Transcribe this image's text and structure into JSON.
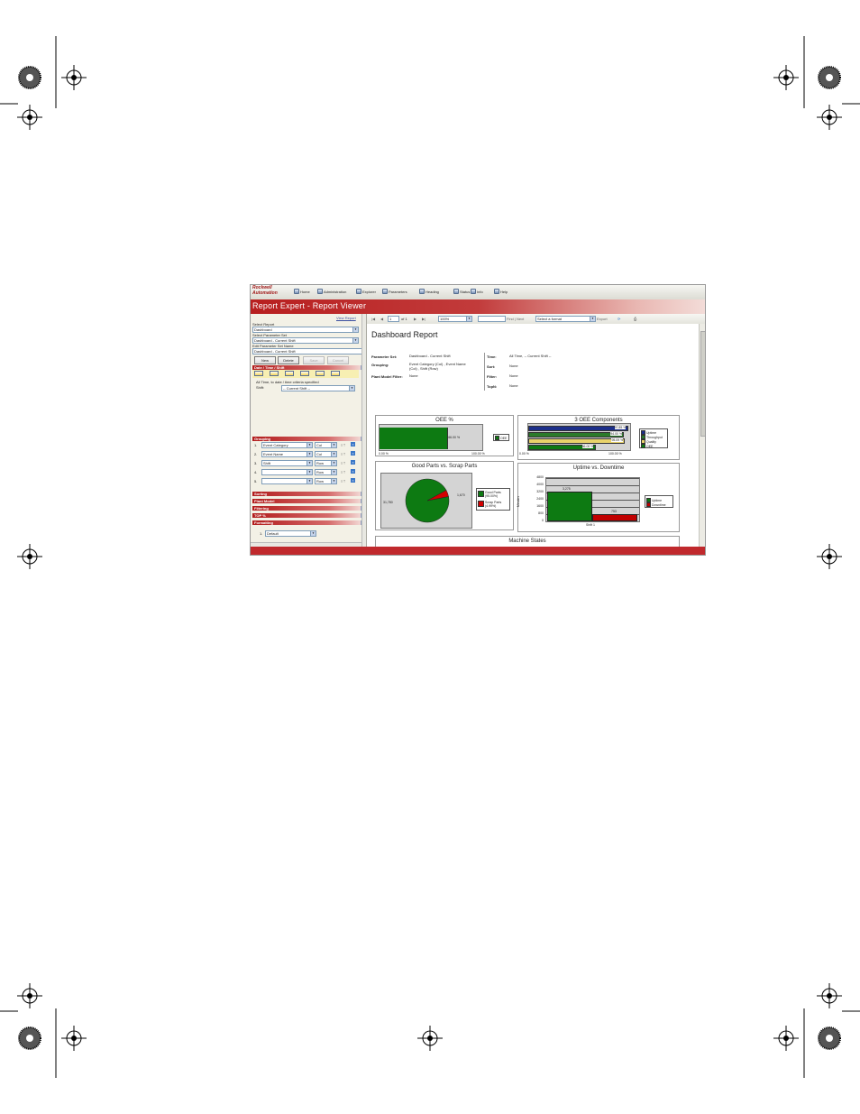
{
  "colors": {
    "red": "#b81f1f",
    "green": "#0d7a12",
    "chart_gray": "#d4d4d4"
  },
  "nav": {
    "logo_line1": "Rockwell",
    "logo_line2": "Automation",
    "items": [
      {
        "label": "Home",
        "icon": "home-icon"
      },
      {
        "label": "Administration",
        "icon": "administration-icon"
      },
      {
        "label": "Explorer",
        "icon": "explorer-icon"
      },
      {
        "label": "Parameters",
        "icon": "parameters-icon"
      },
      {
        "label": "Heading",
        "icon": "heading-icon"
      },
      {
        "label": "Status",
        "icon": "status-icon"
      },
      {
        "label": "Info",
        "icon": "info-icon"
      },
      {
        "label": "Help",
        "icon": "help-icon"
      }
    ]
  },
  "banner": {
    "title": "Report Expert - Report Viewer"
  },
  "left": {
    "view_report": "View Report",
    "select_report_label": "Select Report",
    "select_report_value": "Dashboard",
    "select_paramset_label": "Select Parameter Set",
    "select_paramset_value": "Dashboard - Current Shift",
    "edit_paramset_label": "Edit Parameter Set Name",
    "edit_paramset_value": "Dashboard - Current Shift",
    "buttons": {
      "new": "New",
      "delete": "Delete",
      "save": "Save",
      "cancel": "Cancel"
    },
    "sec_datetime": "Date / Time / Shift",
    "datetime_note": "All Time, to date / time criteria specified",
    "shift_label": "Shift:",
    "shift_value": "-- Current Shift --",
    "sec_grouping": "Grouping",
    "grouping_rows": [
      {
        "num": "1.",
        "field": "Event Category",
        "axis": "Col"
      },
      {
        "num": "2.",
        "field": "Event Name",
        "axis": "Col"
      },
      {
        "num": "3.",
        "field": "Shift",
        "axis": "Row"
      },
      {
        "num": "4.",
        "field": "",
        "axis": "Row"
      },
      {
        "num": "5.",
        "field": "",
        "axis": "Row"
      }
    ],
    "sec_sorting": "Sorting",
    "sec_plant": "Plant Model",
    "sec_filtering": "Filtering",
    "sec_topn": "TOP %",
    "sec_formatting": "Formatting",
    "format_num": "1.",
    "format_value": "Default"
  },
  "toolbar": {
    "page_value": "1",
    "of_label": "of 1",
    "zoom": "100%",
    "find_label": "Find | Next",
    "format_select": "Select a format",
    "export": "Export"
  },
  "report": {
    "title": "Dashboard Report",
    "info_left": [
      {
        "k": "Parameter Set:",
        "v": "Dashboard - Current Shift"
      },
      {
        "k": "Grouping:",
        "v": "Event Category (Col) , Event Name (Col) , Shift (Row)"
      },
      {
        "k": "Plant Model Filter:",
        "v": "None"
      }
    ],
    "info_right": [
      {
        "k": "Time:",
        "v": "All Time, -- Current Shift --"
      },
      {
        "k": "Sort:",
        "v": "None"
      },
      {
        "k": "Filter:",
        "v": "None"
      },
      {
        "k": "TopN:",
        "v": "None"
      }
    ],
    "machine_states_title": "Machine States"
  },
  "chart_data": [
    {
      "type": "bar",
      "title": "OEE %",
      "categories": [
        "OEE"
      ],
      "values": [
        66.0
      ],
      "value_labels": [
        "66.00 %"
      ],
      "xlim": [
        0,
        100
      ],
      "tick_labels": [
        "0.00 %",
        "100.00 %"
      ],
      "legend": [
        "OEE"
      ]
    },
    {
      "type": "bar",
      "title": "3 OEE Components",
      "categories": [
        "Uptime",
        "Throughput",
        "Quality",
        "OEE"
      ],
      "values": [
        97.85,
        94.0,
        95.09,
        66.0
      ],
      "value_labels": [
        "97.85 %",
        "94.00 %",
        "95.09 %",
        "66.00 %"
      ],
      "xlim": [
        0,
        100
      ],
      "tick_labels": [
        "0.00 %",
        "100.00 %"
      ],
      "legend": [
        "Uptime",
        "Throughput",
        "Quality",
        "OEE"
      ],
      "colors": [
        "#1c2f8a",
        "#2a7a2a",
        "#e9d36a",
        "#0d7a12"
      ]
    },
    {
      "type": "pie",
      "title": "Good Parts vs. Scrap Parts",
      "labels": [
        "Good Parts (95.00%)",
        "Scrap Parts (4.99%)"
      ],
      "values": [
        31780,
        1670
      ],
      "value_labels": [
        "31,780",
        "1,670"
      ],
      "colors": [
        "#0d7a12",
        "#d40000"
      ]
    },
    {
      "type": "bar",
      "title": "Uptime vs. Downtime",
      "categories": [
        "Shift 1"
      ],
      "ylabel": "Minutes",
      "ylim": [
        0,
        4800
      ],
      "yticks": [
        0,
        800,
        1600,
        2400,
        3200,
        4000,
        4800
      ],
      "series": [
        {
          "name": "Uptime",
          "values": [
            3275
          ],
          "value_labels": [
            "3,275"
          ]
        },
        {
          "name": "Downtime",
          "values": [
            753
          ],
          "value_labels": [
            "753"
          ]
        }
      ],
      "colors": [
        "#0d7a12",
        "#c00000"
      ]
    }
  ]
}
